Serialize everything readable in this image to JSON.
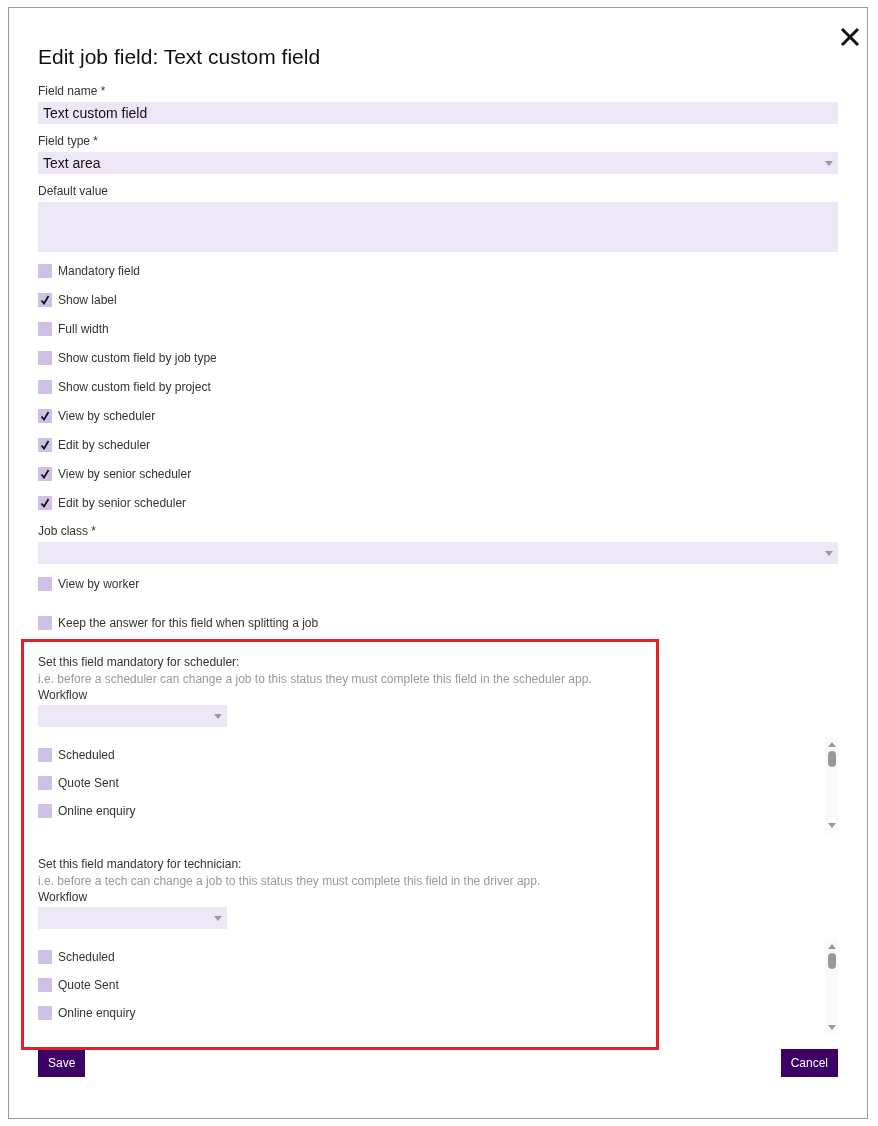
{
  "dialog": {
    "title": "Edit job field: Text custom field"
  },
  "fields": [
    {
      "label": "Field name *",
      "value": "Text custom field",
      "kind": "text"
    },
    {
      "label": "Field type *",
      "value": "Text area",
      "kind": "select"
    },
    {
      "label": "Default value",
      "kind": "textarea"
    }
  ],
  "options": [
    {
      "label": "Mandatory field",
      "checked": false
    },
    {
      "label": "Show label",
      "checked": true
    },
    {
      "label": "Full width",
      "checked": false
    },
    {
      "label": "Show custom field by job type",
      "checked": false
    },
    {
      "label": "Show custom field by project",
      "checked": false
    },
    {
      "label": "View by scheduler",
      "checked": true
    },
    {
      "label": "Edit by scheduler",
      "checked": true
    },
    {
      "label": "View by senior scheduler",
      "checked": true
    },
    {
      "label": "Edit by senior scheduler",
      "checked": true
    }
  ],
  "job_class": {
    "label": "Job class *"
  },
  "more_options": [
    {
      "label": "View by worker",
      "checked": false
    },
    {
      "label": "Keep the answer for this field when splitting a job",
      "checked": false
    }
  ],
  "mandatory_sections": [
    {
      "title": "Set this field mandatory for scheduler:",
      "hint": "i.e. before a scheduler can change a job to this status they must complete this field in the scheduler app.",
      "workflow_label": "Workflow",
      "statuses": [
        {
          "label": "Scheduled",
          "checked": false
        },
        {
          "label": "Quote Sent",
          "checked": false
        },
        {
          "label": "Online enquiry",
          "checked": false
        }
      ]
    },
    {
      "title": "Set this field mandatory for technician:",
      "hint": "i.e. before a tech can change a job to this status they must complete this field in the driver app.",
      "workflow_label": "Workflow",
      "statuses": [
        {
          "label": "Scheduled",
          "checked": false
        },
        {
          "label": "Quote Sent",
          "checked": false
        },
        {
          "label": "Online enquiry",
          "checked": false
        }
      ]
    }
  ],
  "buttons": {
    "save": "Save",
    "cancel": "Cancel"
  }
}
